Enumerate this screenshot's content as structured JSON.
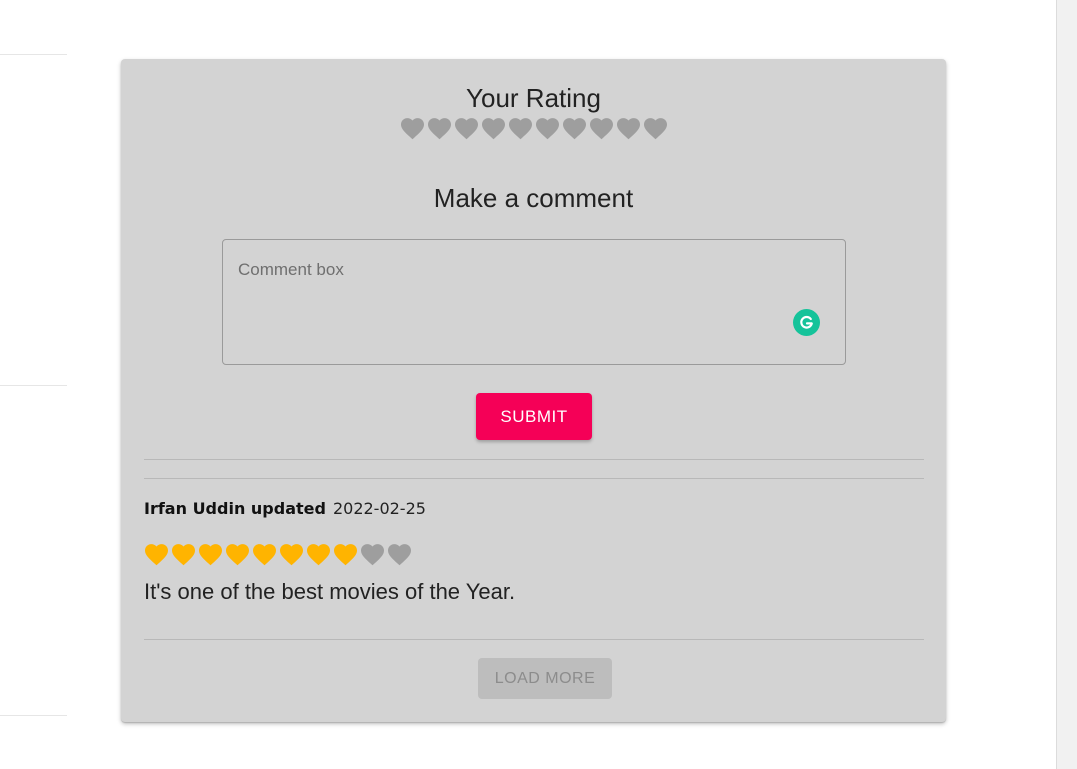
{
  "rating_section": {
    "title": "Your Rating",
    "rating_value": 0,
    "max_rating": 10
  },
  "comment_section": {
    "title": "Make a comment",
    "comment_box": {
      "placeholder": "Comment box",
      "value": ""
    },
    "submit_label": "SUBMIT"
  },
  "reviews": [
    {
      "author": "Irfan Uddin updated",
      "date": "2022-02-25",
      "rating": 8,
      "max_rating": 10,
      "text": "It's one of the best movies of the Year."
    }
  ],
  "load_more_label": "LOAD MORE",
  "icons": {
    "heart_icon": "heart-icon",
    "grammarly_icon": "grammarly-icon"
  },
  "colors": {
    "card_background": "#d3d3d3",
    "heart_empty": "#9e9e9e",
    "heart_filled": "#ffb400",
    "submit_button": "#f50057",
    "grammarly": "#15c39a"
  }
}
